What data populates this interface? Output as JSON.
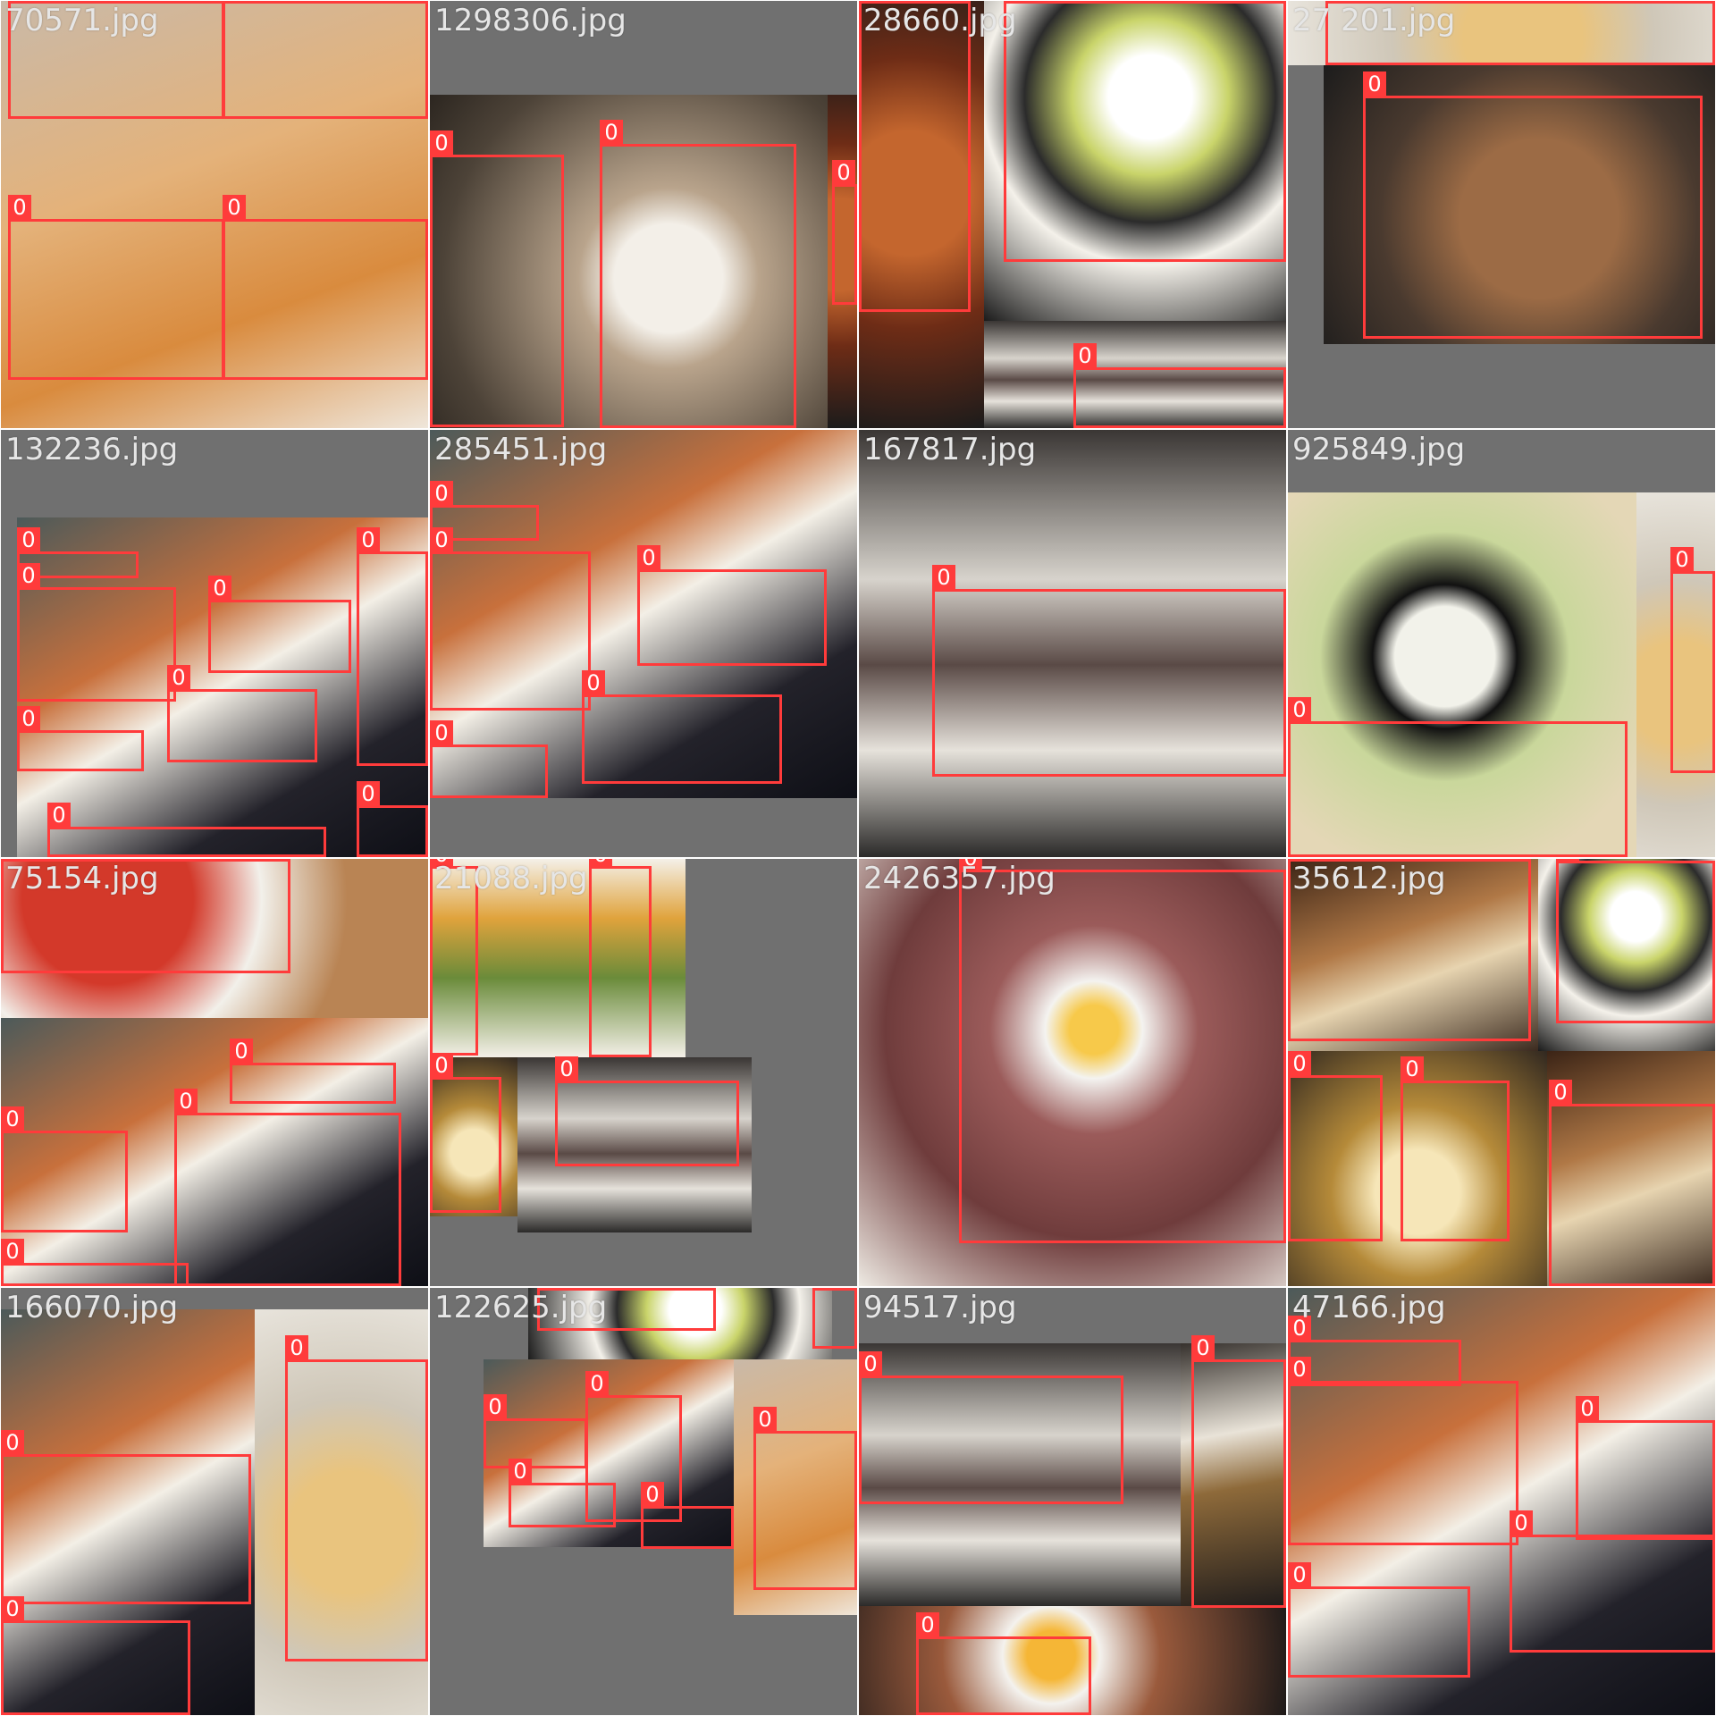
{
  "mosaic": {
    "tiles": [
      {
        "label": "70571.jpg",
        "box_class": "0"
      },
      {
        "label": "1298306.jpg",
        "box_class": "0"
      },
      {
        "label": "28660.jpg",
        "box_class": "0"
      },
      {
        "label": "27 201.jpg",
        "box_class": "0"
      },
      {
        "label": "132236.jpg",
        "box_class": "0"
      },
      {
        "label": "285451.jpg",
        "box_class": "0"
      },
      {
        "label": "167817.jpg",
        "box_class": "0"
      },
      {
        "label": "925849.jpg",
        "box_class": "0"
      },
      {
        "label": "75154.jpg",
        "box_class": "0"
      },
      {
        "label": "21088.jpg",
        "box_class": "0"
      },
      {
        "label": "2426357.jpg",
        "box_class": "0"
      },
      {
        "label": "35612.jpg",
        "box_class": "0"
      },
      {
        "label": "166070.jpg",
        "box_class": "0"
      },
      {
        "label": "122625.jpg",
        "box_class": "0"
      },
      {
        "label": "94517.jpg",
        "box_class": "0"
      },
      {
        "label": "47166.jpg",
        "box_class": "0"
      }
    ],
    "colors": {
      "box": "#ff3b3b",
      "label_text": "#e6e6e6",
      "padding_gray": "#707070"
    }
  }
}
